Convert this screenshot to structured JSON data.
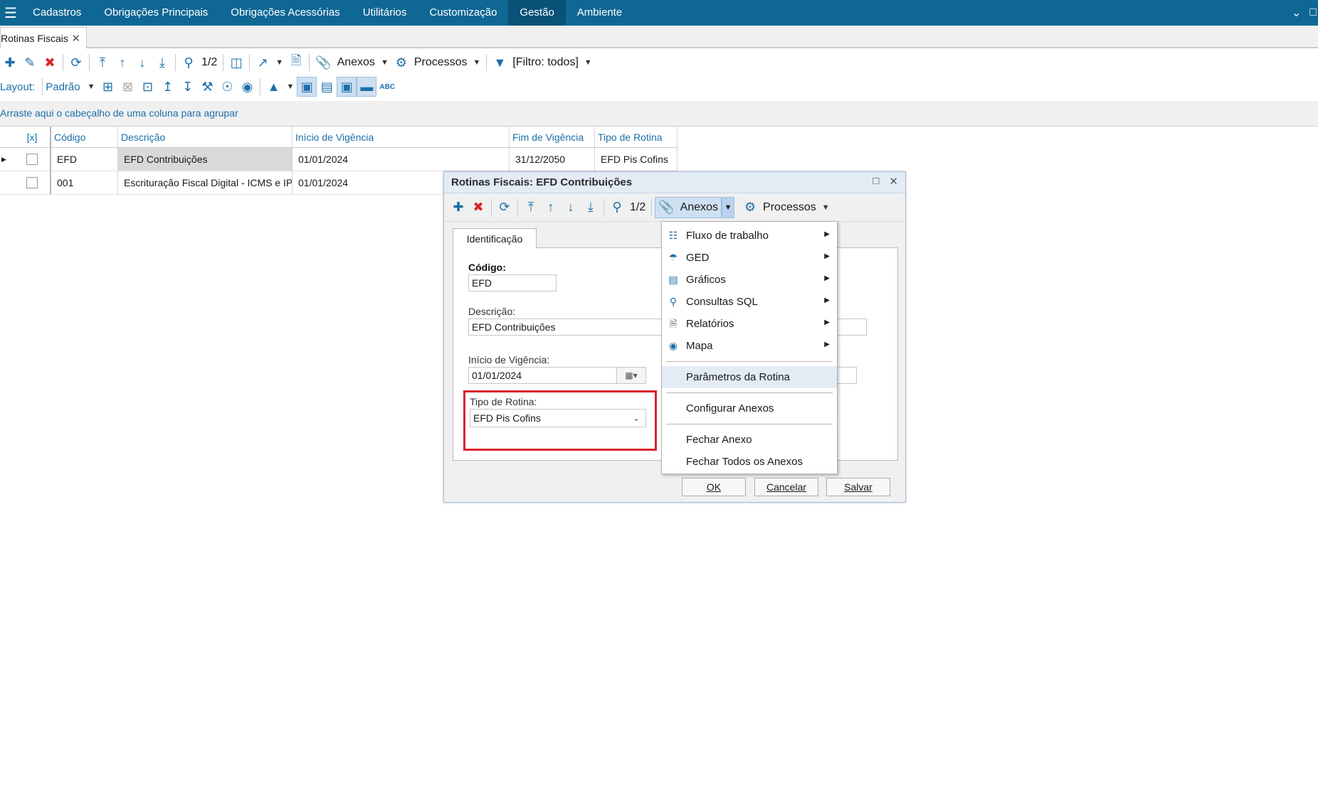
{
  "menubar": {
    "items": [
      "Cadastros",
      "Obrigações Principais",
      "Obrigações Acessórias",
      "Utilitários",
      "Customização",
      "Gestão",
      "Ambiente"
    ],
    "active_index": 5
  },
  "tabs": {
    "doc_tab_label": "Rotinas Fiscais"
  },
  "toolbar": {
    "page_counter": "1/2",
    "anexos_label": "Anexos",
    "processos_label": "Processos",
    "filtro_label": "[Filtro: todos]",
    "layout_label": "Layout:",
    "layout_value": "Padrão"
  },
  "group_panel": {
    "text": "Arraste aqui o cabeçalho de uma coluna para agrupar"
  },
  "grid": {
    "headers": [
      "[x]",
      "Código",
      "Descrição",
      "Início de Vigência",
      "Fim de Vigência",
      "Tipo de Rotina"
    ],
    "rows": [
      {
        "codigo": "EFD",
        "descricao": "EFD Contribuições",
        "inicio": "01/01/2024",
        "fim": "31/12/2050",
        "tipo": "EFD Pis Cofins"
      },
      {
        "codigo": "001",
        "descricao": "Escrituração Fiscal Digital - ICMS e IPI",
        "inicio": "01/01/2024",
        "fim": "",
        "tipo": ""
      }
    ]
  },
  "dialog": {
    "title": "Rotinas Fiscais: EFD Contribuições",
    "page_counter": "1/2",
    "anexos_label": "Anexos",
    "processos_label": "Processos",
    "tab_label": "Identificação",
    "codigo_label": "Código:",
    "codigo_value": "EFD",
    "descricao_label": "Descrição:",
    "descricao_value": "EFD Contribuições",
    "inicio_label": "Início de Vigência:",
    "inicio_value": "01/01/2024",
    "tipo_label": "Tipo de Rotina:",
    "tipo_value": "EFD Pis Cofins",
    "ok_label": "OK",
    "cancel_label": "Cancelar",
    "save_label": "Salvar"
  },
  "context_menu": {
    "items": [
      {
        "label": "Fluxo de trabalho",
        "icon": "workflow-icon",
        "submenu": true
      },
      {
        "label": "GED",
        "icon": "ged-icon",
        "submenu": true
      },
      {
        "label": "Gráficos",
        "icon": "chart-icon",
        "submenu": true
      },
      {
        "label": "Consultas SQL",
        "icon": "search-icon",
        "submenu": true
      },
      {
        "label": "Relatórios",
        "icon": "report-icon",
        "submenu": true
      },
      {
        "label": "Mapa",
        "icon": "map-pin-icon",
        "submenu": true
      }
    ],
    "parametros_label": "Parâmetros da Rotina",
    "configurar_label": "Configurar Anexos",
    "fechar_label": "Fechar Anexo",
    "fechar_todos_label": "Fechar Todos os Anexos"
  },
  "colors": {
    "menubar": "#0f6794",
    "accent": "#1d6fa8",
    "delete": "#d62828",
    "highlight": "#d92230",
    "hover": "#e3ebf5"
  }
}
